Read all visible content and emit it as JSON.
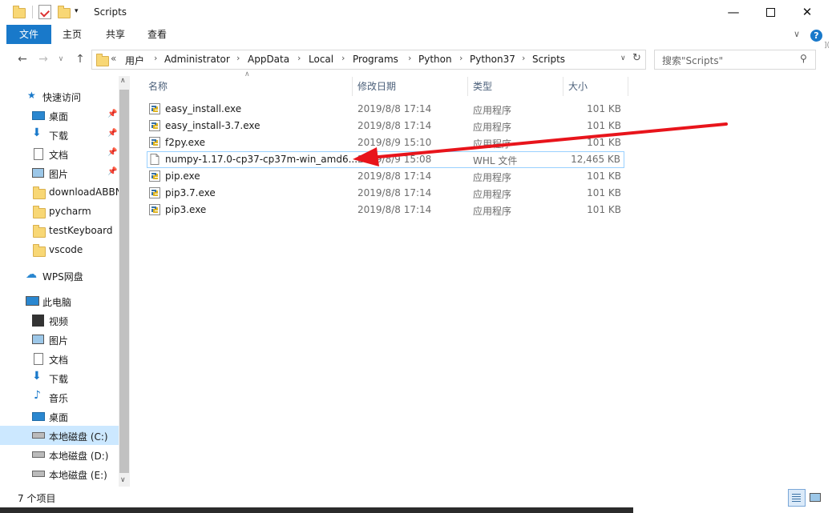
{
  "window": {
    "title": "Scripts"
  },
  "ribbon": {
    "tabs": [
      {
        "label": "文件"
      },
      {
        "label": "主页"
      },
      {
        "label": "共享"
      },
      {
        "label": "查看"
      }
    ]
  },
  "address": {
    "prefix": "«",
    "crumbs": [
      "用户",
      "Administrator",
      "AppData",
      "Local",
      "Programs",
      "Python",
      "Python37",
      "Scripts"
    ]
  },
  "search": {
    "placeholder": "搜索\"Scripts\""
  },
  "nav": {
    "quick_access": "快速访问",
    "items": [
      {
        "label": "桌面"
      },
      {
        "label": "下载"
      },
      {
        "label": "文档"
      },
      {
        "label": "图片"
      },
      {
        "label": "downloadABBN"
      },
      {
        "label": "pycharm"
      },
      {
        "label": "testKeyboard"
      },
      {
        "label": "vscode"
      },
      {
        "label": "WPS网盘"
      },
      {
        "label": "此电脑"
      },
      {
        "label": "视频"
      },
      {
        "label": "图片"
      },
      {
        "label": "文档"
      },
      {
        "label": "下载"
      },
      {
        "label": "音乐"
      },
      {
        "label": "桌面"
      },
      {
        "label": "本地磁盘 (C:)"
      },
      {
        "label": "本地磁盘 (D:)"
      },
      {
        "label": "本地磁盘 (E:)"
      }
    ]
  },
  "columns": {
    "name": "名称",
    "date": "修改日期",
    "type": "类型",
    "size": "大小"
  },
  "files": [
    {
      "name": "easy_install.exe",
      "date": "2019/8/8 17:14",
      "type": "应用程序",
      "size": "101 KB"
    },
    {
      "name": "easy_install-3.7.exe",
      "date": "2019/8/8 17:14",
      "type": "应用程序",
      "size": "101 KB"
    },
    {
      "name": "f2py.exe",
      "date": "2019/8/9 15:10",
      "type": "应用程序",
      "size": "101 KB"
    },
    {
      "name": "numpy-1.17.0-cp37-cp37m-win_amd6...",
      "date": "2019/8/9 15:08",
      "type": "WHL 文件",
      "size": "12,465 KB"
    },
    {
      "name": "pip.exe",
      "date": "2019/8/8 17:14",
      "type": "应用程序",
      "size": "101 KB"
    },
    {
      "name": "pip3.7.exe",
      "date": "2019/8/8 17:14",
      "type": "应用程序",
      "size": "101 KB"
    },
    {
      "name": "pip3.exe",
      "date": "2019/8/8 17:14",
      "type": "应用程序",
      "size": "101 KB"
    }
  ],
  "status": {
    "count": "7 个项目"
  },
  "colors": {
    "accent": "#1979ca",
    "arrow": "#e8141b",
    "selection": "#cce8ff"
  }
}
